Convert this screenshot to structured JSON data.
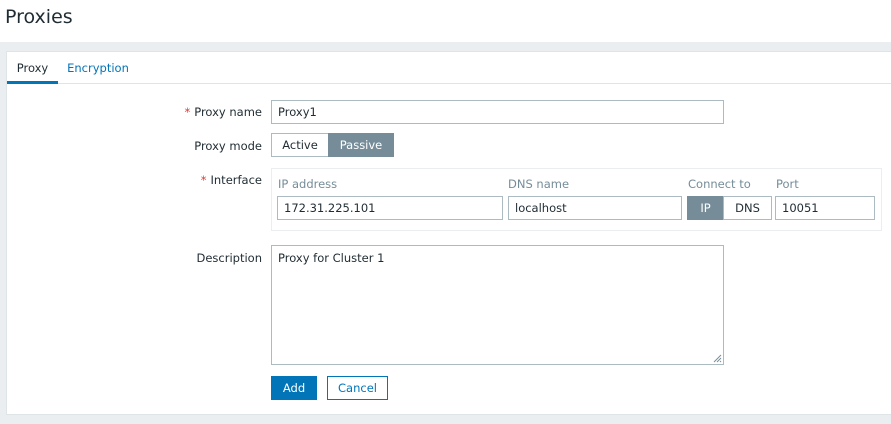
{
  "page": {
    "title": "Proxies"
  },
  "tabs": [
    {
      "label": "Proxy",
      "active": true
    },
    {
      "label": "Encryption",
      "active": false
    }
  ],
  "form": {
    "proxy_name": {
      "label": "Proxy name",
      "required": "*",
      "value": "Proxy1"
    },
    "proxy_mode": {
      "label": "Proxy mode",
      "options": [
        "Active",
        "Passive"
      ],
      "selected": "Passive"
    },
    "interface": {
      "label": "Interface",
      "required": "*",
      "columns": {
        "ip": "IP address",
        "dns": "DNS name",
        "connect": "Connect to",
        "port": "Port"
      },
      "ip_value": "172.31.225.101",
      "dns_value": "localhost",
      "connect_options": [
        "IP",
        "DNS"
      ],
      "connect_selected": "IP",
      "port_value": "10051"
    },
    "description": {
      "label": "Description",
      "value": "Proxy for Cluster 1"
    }
  },
  "buttons": {
    "add": "Add",
    "cancel": "Cancel"
  },
  "colors": {
    "accent": "#0275b8",
    "selected_segment": "#768d99",
    "required": "#e33734"
  },
  "icons": {
    "resize": "resize-handle-icon"
  }
}
